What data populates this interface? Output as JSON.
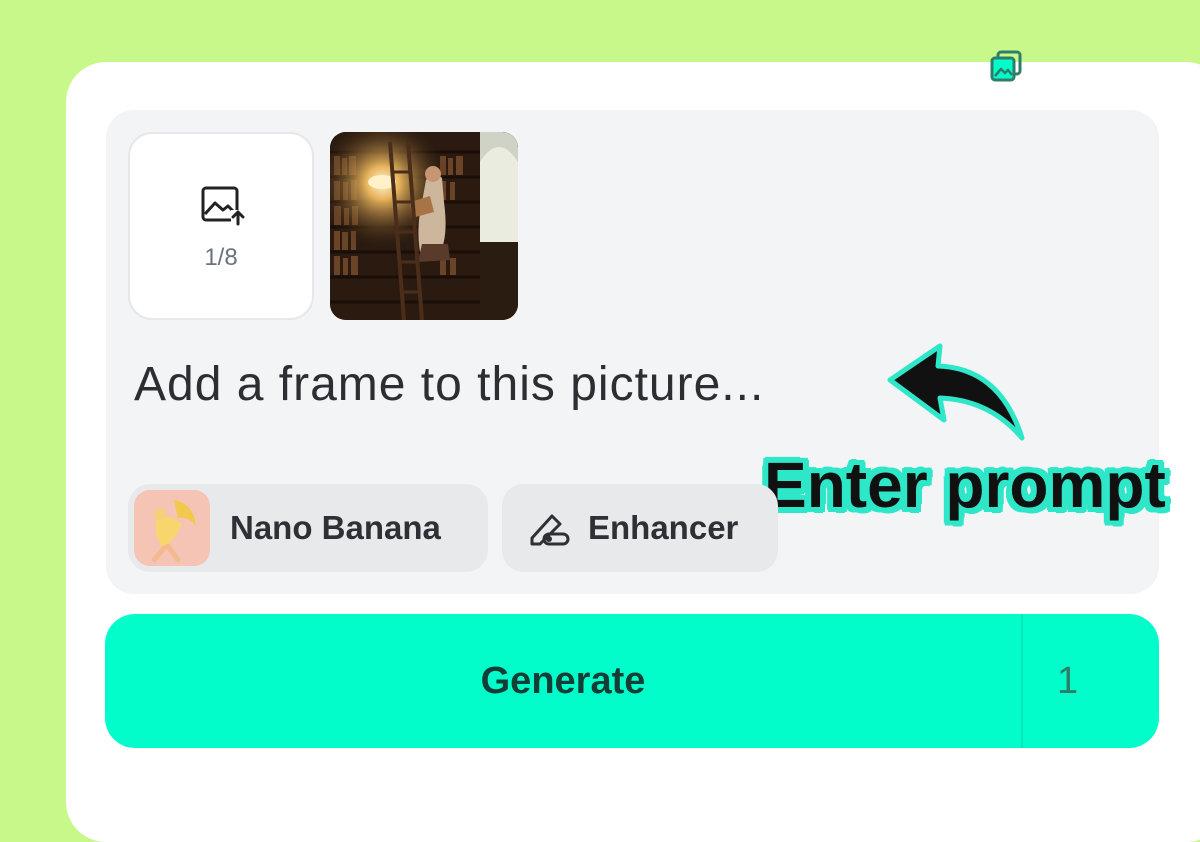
{
  "upload": {
    "count": "1/8",
    "icon": "image-upload-icon"
  },
  "reference_image": {
    "icon": "reference-photo-library"
  },
  "prompt": {
    "text": "Add a frame to this picture..."
  },
  "chips": {
    "model_label": "Nano Banana",
    "enhancer_label": "Enhancer"
  },
  "generate": {
    "label": "Generate",
    "credits": "1",
    "credits_icon": "image-count-icon"
  },
  "callout": {
    "label": "Enter prompt"
  },
  "colors": {
    "background": "#c8f78a",
    "accent": "#03fdca",
    "callout_outline": "#2ee7c8"
  }
}
